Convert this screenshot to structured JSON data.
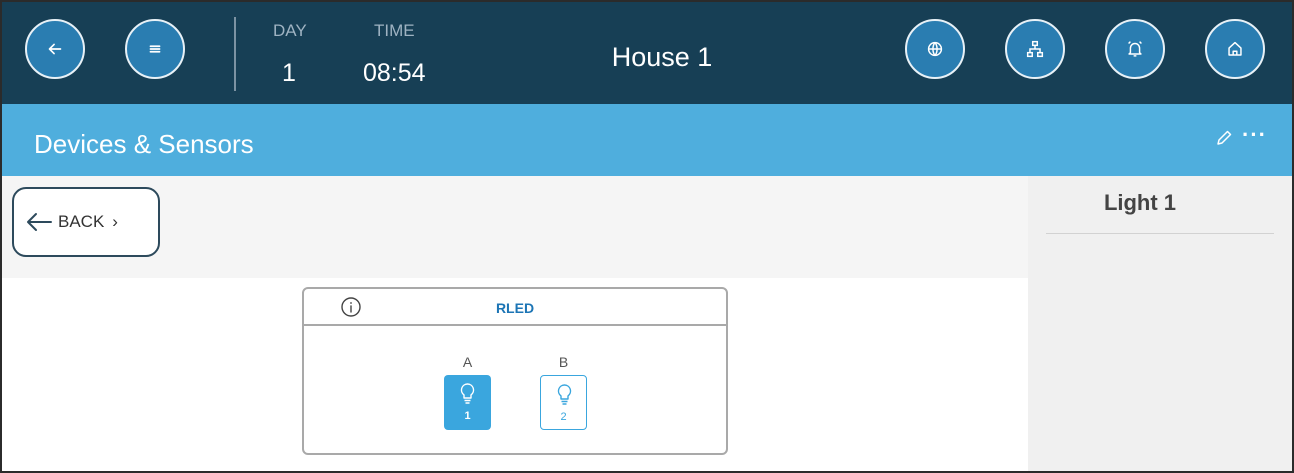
{
  "header": {
    "day_label": "DAY",
    "day_value": "1",
    "time_label": "TIME",
    "time_value": "08:54",
    "house_title": "House 1",
    "left_buttons": [
      "back-arrow-icon",
      "menu-icon"
    ],
    "right_buttons": [
      "globe-icon",
      "network-icon",
      "alarm-bell-icon",
      "home-icon"
    ]
  },
  "section": {
    "title": "Devices & Sensors",
    "actions": [
      "pencil-icon",
      "more-icon"
    ]
  },
  "back_button": {
    "label": "BACK",
    "chevron": "›"
  },
  "right_panel": {
    "title": "Light 1"
  },
  "device_card": {
    "title": "RLED",
    "channels": [
      {
        "label": "A",
        "number": "1",
        "state": "active",
        "icon": "light-bulb-icon"
      },
      {
        "label": "B",
        "number": "2",
        "state": "inactive",
        "icon": "light-bulb-icon"
      }
    ]
  },
  "colors": {
    "topbar": "#173f55",
    "circle_button": "#2a7db1",
    "section_bar": "#4faedd",
    "accent": "#3aa6de",
    "card_title": "#1c75b5"
  }
}
